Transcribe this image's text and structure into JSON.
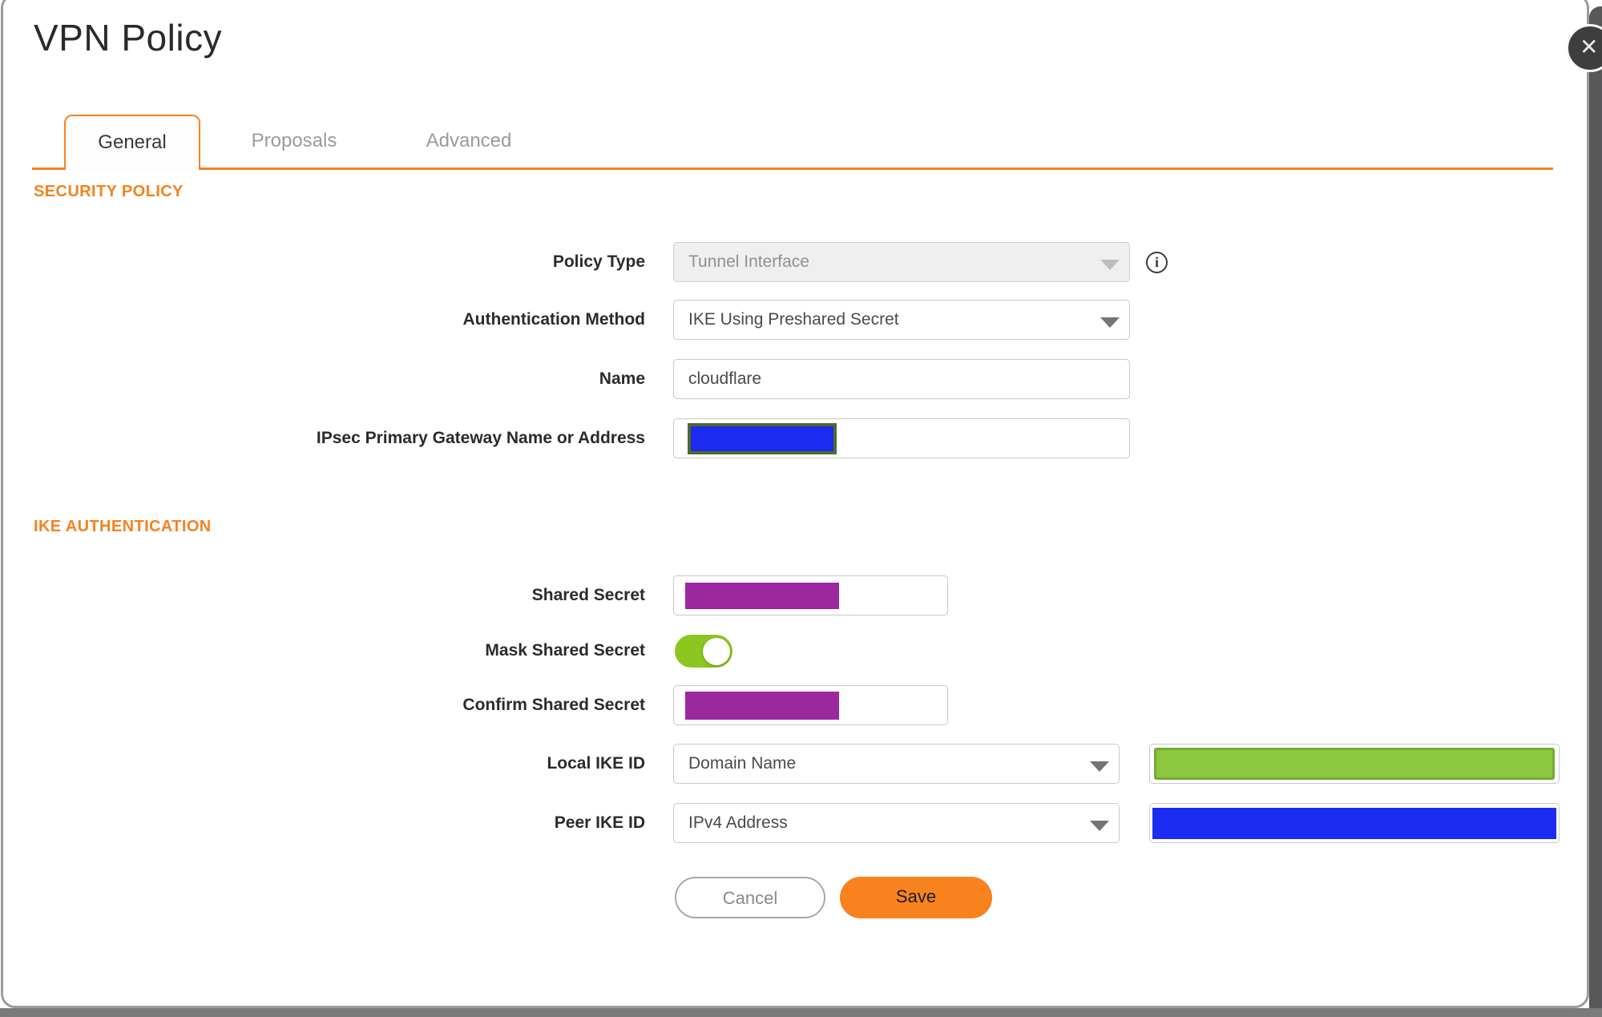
{
  "dialog": {
    "title": "VPN Policy"
  },
  "close": {
    "glyph": "✕"
  },
  "tabs": [
    {
      "label": "General",
      "active": true
    },
    {
      "label": "Proposals",
      "active": false
    },
    {
      "label": "Advanced",
      "active": false
    }
  ],
  "sections": {
    "security_policy": "SECURITY POLICY",
    "ike_authentication": "IKE AUTHENTICATION"
  },
  "fields": {
    "policy_type": {
      "label": "Policy Type",
      "value": "Tunnel Interface",
      "disabled": true
    },
    "auth_method": {
      "label": "Authentication Method",
      "value": "IKE Using Preshared Secret"
    },
    "name": {
      "label": "Name",
      "value": "cloudflare"
    },
    "gateway": {
      "label": "IPsec Primary Gateway Name or Address",
      "value": "",
      "redaction_color": "#1B2BF0"
    },
    "shared_secret": {
      "label": "Shared Secret",
      "value": "",
      "redaction_color": "#9C28A0"
    },
    "mask_shared_secret": {
      "label": "Mask Shared Secret",
      "state": "on"
    },
    "confirm_shared_secret": {
      "label": "Confirm Shared Secret",
      "value": "",
      "redaction_color": "#9C28A0"
    },
    "local_ike_id": {
      "label": "Local IKE ID",
      "value": "Domain Name",
      "redaction_color": "#8DC63F"
    },
    "peer_ike_id": {
      "label": "Peer IKE ID",
      "value": "IPv4 Address",
      "redaction_color": "#1B2BF0"
    }
  },
  "icons": {
    "info_glyph": "i"
  },
  "buttons": {
    "cancel": "Cancel",
    "save": "Save"
  },
  "colors": {
    "accent_orange": "#F5821F",
    "save_orange": "#F7821E",
    "toggle_green": "#8CC721",
    "redact_blue": "#1B2BF0",
    "redact_purple": "#9C28A0",
    "redact_green": "#8DC63F",
    "redact_olive_border": "#4E6B27"
  }
}
